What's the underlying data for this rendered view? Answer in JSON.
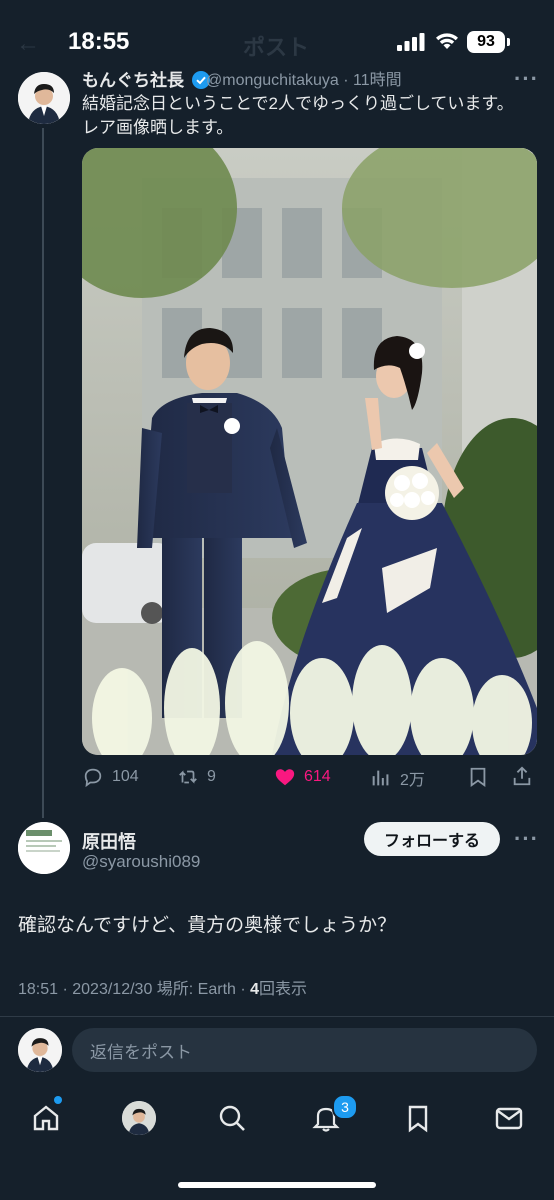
{
  "status_bar": {
    "time": "18:55",
    "battery": "93",
    "header_title": "ポスト"
  },
  "tweet": {
    "author_name": "もんぐち社長",
    "handle_time": "@monguchitakuya · 11時間",
    "text": "結婚記念日ということで2人でゆっくり過ごしています。\nレア画像晒します。",
    "actions": {
      "replies": "104",
      "retweets": "9",
      "likes": "614",
      "views": "2万"
    }
  },
  "reply": {
    "name": "原田悟",
    "handle": "@syaroushi089",
    "follow_label": "フォローする",
    "text": "確認なんですけど、貴方の奥様でしょうか？",
    "meta_prefix": "18:51 · 2023/12/30  場所: Earth · ",
    "views_count": "4",
    "views_suffix": "回表示"
  },
  "reply_box": {
    "placeholder": "返信をポスト"
  },
  "tab_bar": {
    "notifications_badge": "3"
  },
  "colors": {
    "like": "#f91880",
    "accent": "#1d9bf0",
    "background": "#15202b"
  }
}
